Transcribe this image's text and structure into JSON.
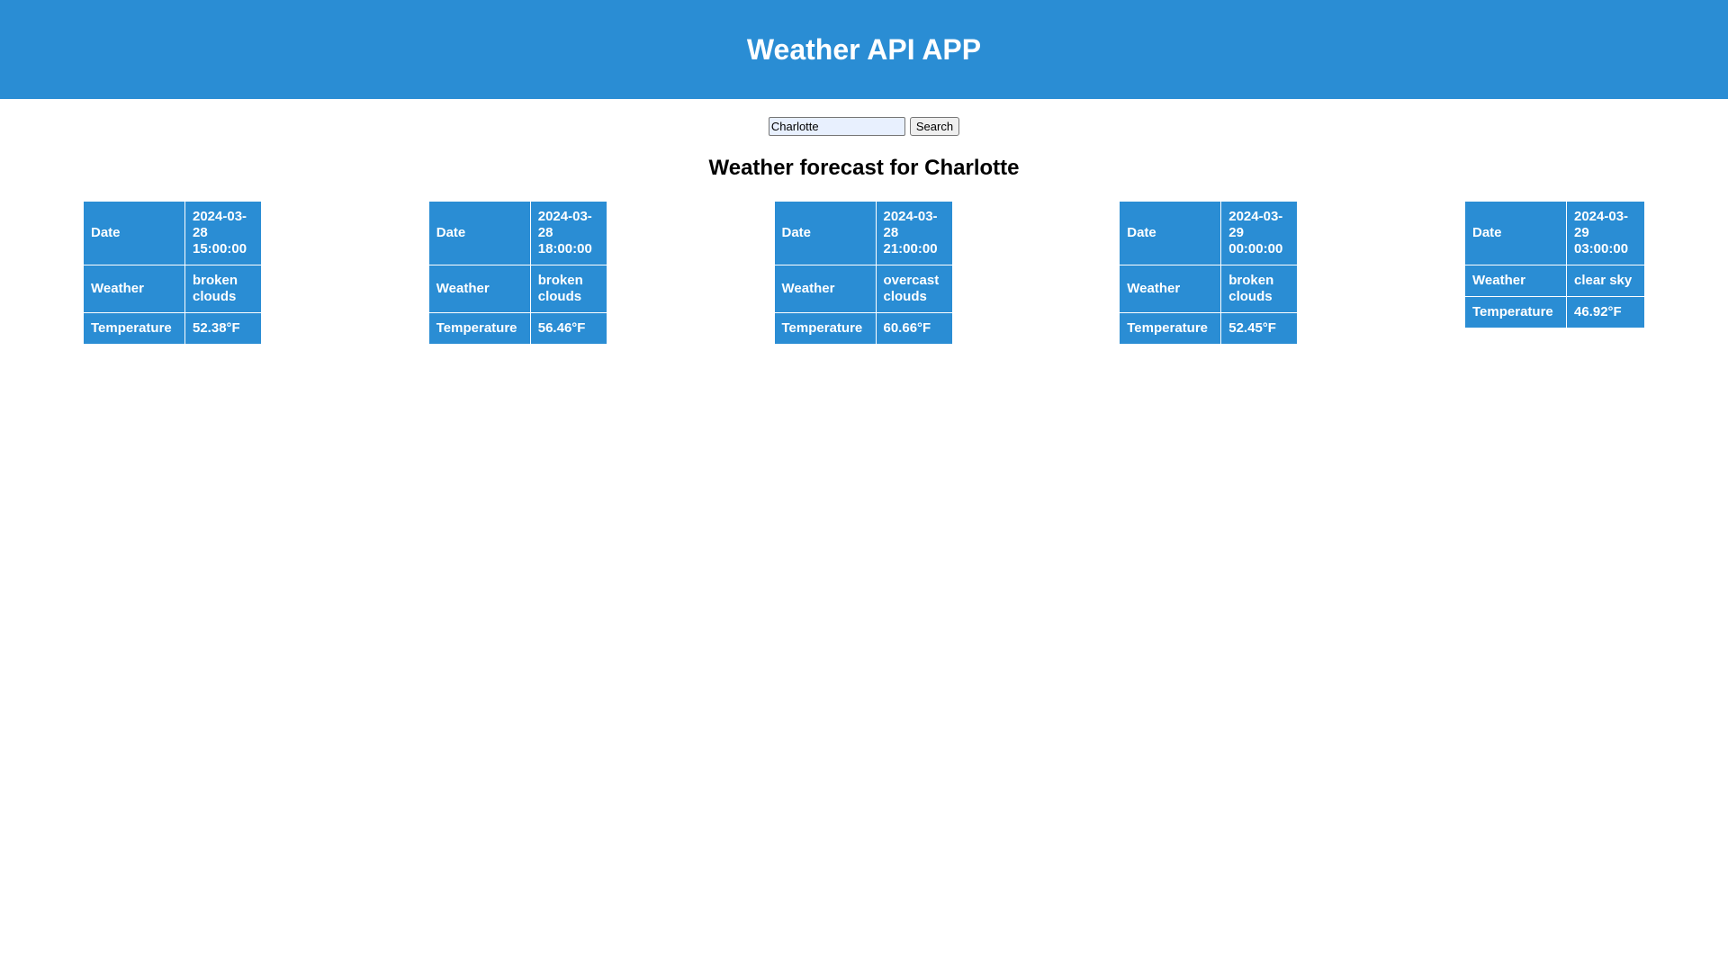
{
  "header": {
    "title": "Weather API APP"
  },
  "search": {
    "value": "Charlotte",
    "button_label": "Search"
  },
  "forecast": {
    "heading": "Weather forecast for Charlotte",
    "row_labels": {
      "date": "Date",
      "weather": "Weather",
      "temperature": "Temperature"
    },
    "items": [
      {
        "date": "2024-03-28 15:00:00",
        "weather": "broken clouds",
        "temperature": "52.38°F"
      },
      {
        "date": "2024-03-28 18:00:00",
        "weather": "broken clouds",
        "temperature": "56.46°F"
      },
      {
        "date": "2024-03-28 21:00:00",
        "weather": "overcast clouds",
        "temperature": "60.66°F"
      },
      {
        "date": "2024-03-29 00:00:00",
        "weather": "broken clouds",
        "temperature": "52.45°F"
      },
      {
        "date": "2024-03-29 03:00:00",
        "weather": "clear sky",
        "temperature": "46.92°F"
      }
    ]
  },
  "colors": {
    "accent": "#2a8dd4",
    "text_on_accent": "#ffffff"
  }
}
